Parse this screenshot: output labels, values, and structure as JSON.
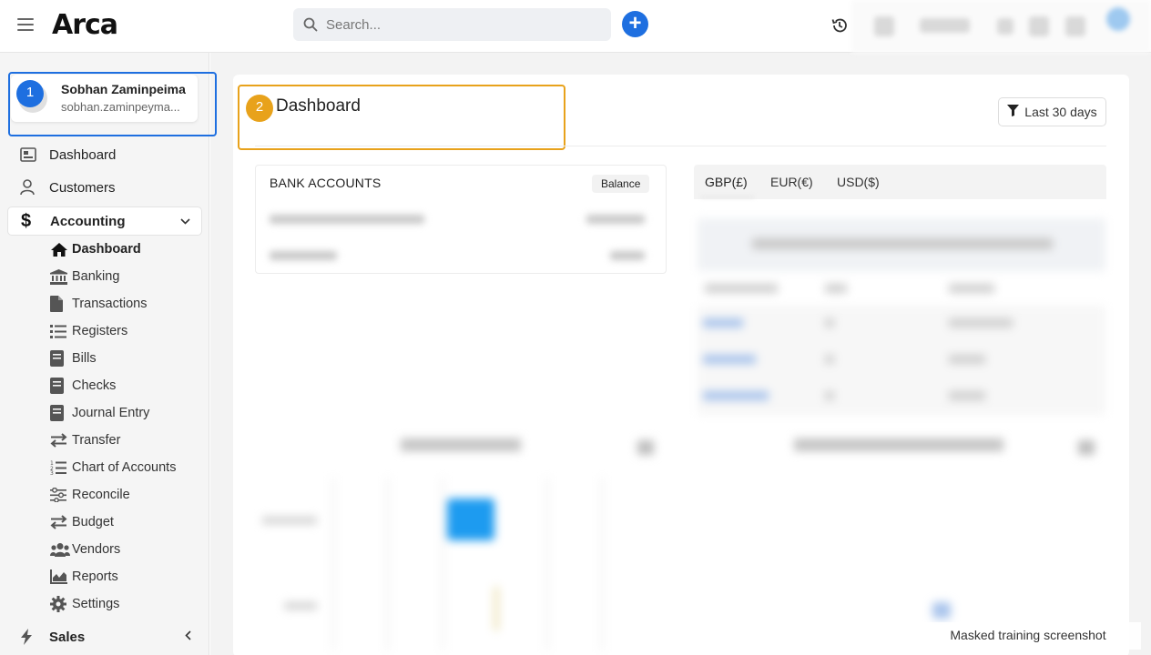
{
  "app": {
    "logo_text": "Arca",
    "brand_accent": "#e8891b"
  },
  "topbar": {
    "search_placeholder": "Search...",
    "add_label": "+",
    "icons": [
      "menu-icon",
      "search-icon",
      "add-icon",
      "history-icon"
    ]
  },
  "annotations": {
    "badge_1": "1",
    "badge_2": "2",
    "box_1_color": "#1e6fe0",
    "box_2_color": "#e8a21b"
  },
  "user": {
    "name": "Sobhan Zaminpeima",
    "email": "sobhan.zaminpeyma..."
  },
  "sidebar": {
    "top_items": [
      {
        "label": "Dashboard",
        "icon": "dashboard-icon"
      },
      {
        "label": "Customers",
        "icon": "user-icon"
      }
    ],
    "accounting": {
      "label": "Accounting",
      "icon": "dollar-icon",
      "expanded": true,
      "items": [
        {
          "label": "Dashboard",
          "icon": "home-icon",
          "current": true
        },
        {
          "label": "Banking",
          "icon": "bank-icon"
        },
        {
          "label": "Transactions",
          "icon": "file-icon"
        },
        {
          "label": "Registers",
          "icon": "list-icon"
        },
        {
          "label": "Bills",
          "icon": "document-icon"
        },
        {
          "label": "Checks",
          "icon": "document-icon"
        },
        {
          "label": "Journal Entry",
          "icon": "document-icon"
        },
        {
          "label": "Transfer",
          "icon": "transfer-icon"
        },
        {
          "label": "Chart of Accounts",
          "icon": "ordered-list-icon"
        },
        {
          "label": "Reconcile",
          "icon": "sliders-icon"
        },
        {
          "label": "Budget",
          "icon": "transfer-icon"
        },
        {
          "label": "Vendors",
          "icon": "users-icon"
        },
        {
          "label": "Reports",
          "icon": "chart-icon"
        },
        {
          "label": "Settings",
          "icon": "gear-icon"
        }
      ]
    },
    "sales": {
      "label": "Sales",
      "icon": "bolt-icon",
      "expanded": false
    }
  },
  "main": {
    "title": "Dashboard",
    "filter_label": "Last 30 days",
    "bank_accounts": {
      "title": "BANK ACCOUNTS",
      "balance_label": "Balance"
    },
    "currency_tabs": [
      "GBP(£)",
      "EUR(€)",
      "USD($)"
    ],
    "active_currency": "GBP(£)"
  },
  "watermark": "Masked training screenshot"
}
